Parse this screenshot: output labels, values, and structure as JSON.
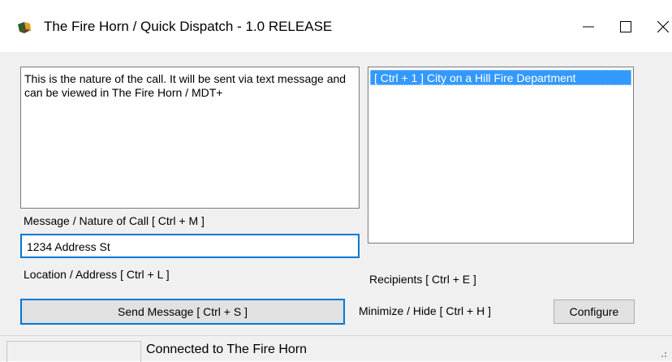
{
  "window": {
    "title": "The Fire Horn / Quick Dispatch - 1.0 RELEASE",
    "icon": "fire-horn-app-icon",
    "controls": {
      "minimize": "minimize-icon",
      "maximize": "maximize-icon",
      "close": "close-icon"
    }
  },
  "message": {
    "text": "This is the nature of the call.  It will be sent via text message and can be viewed in The Fire Horn / MDT+",
    "label": "Message / Nature of Call [ Ctrl + M ]"
  },
  "location": {
    "value": "1234 Address St",
    "label": "Location / Address [ Ctrl + L ]"
  },
  "recipients": {
    "items": [
      "[ Ctrl + 1 ] City on a Hill Fire Department"
    ],
    "selected_index": 0,
    "label": "Recipients [ Ctrl + E ]"
  },
  "buttons": {
    "send": "Send Message [ Ctrl + S ]",
    "configure": "Configure"
  },
  "minimize_hint": "Minimize / Hide [ Ctrl + H ]",
  "status": {
    "text": "Connected to The Fire Horn"
  },
  "colors": {
    "selection": "#3399ff",
    "focus_border": "#0078d7",
    "window_bg": "#f0f0f0"
  }
}
